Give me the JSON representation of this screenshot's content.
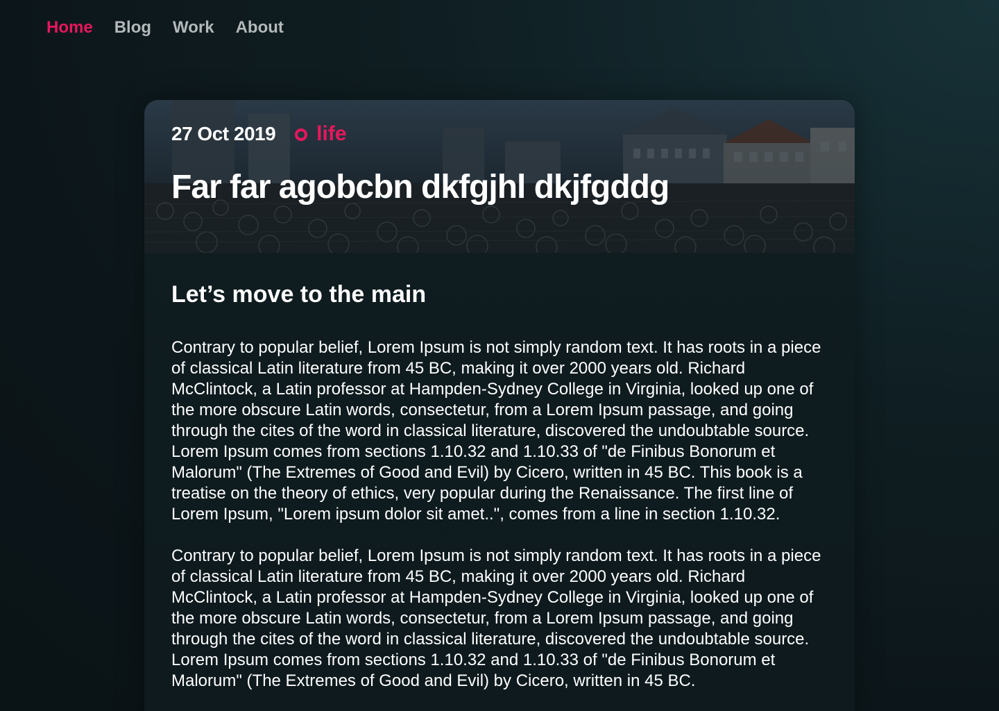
{
  "nav": {
    "items": [
      {
        "label": "Home",
        "active": true
      },
      {
        "label": "Blog",
        "active": false
      },
      {
        "label": "Work",
        "active": false
      },
      {
        "label": "About",
        "active": false
      }
    ]
  },
  "post": {
    "date": "27 Oct 2019",
    "tag": "life",
    "title": "Far far agobcbn dkfgjhl dkjfgddg",
    "hero_image": "bicycles-in-city-square",
    "subheading": "Let’s move to the main",
    "paragraphs": [
      "Contrary to popular belief, Lorem Ipsum is not simply random text. It has roots in a piece of classical Latin literature from 45 BC, making it over 2000 years old. Richard McClintock, a Latin professor at Hampden-Sydney College in Virginia, looked up one of the more obscure Latin words, consectetur, from a Lorem Ipsum passage, and going through the cites of the word in classical literature, discovered the undoubtable source. Lorem Ipsum comes from sections 1.10.32 and 1.10.33 of \"de Finibus Bonorum et Malorum\" (The Extremes of Good and Evil) by Cicero, written in 45 BC. This book is a treatise on the theory of ethics, very popular during the Renaissance. The first line of Lorem Ipsum, \"Lorem ipsum dolor sit amet..\", comes from a line in section 1.10.32.",
      "Contrary to popular belief, Lorem Ipsum is not simply random text. It has roots in a piece of classical Latin literature from 45 BC, making it over 2000 years old. Richard McClintock, a Latin professor at Hampden-Sydney College in Virginia, looked up one of the more obscure Latin words, consectetur, from a Lorem Ipsum passage, and going through the cites of the word in classical literature, discovered the undoubtable source. Lorem Ipsum comes from sections 1.10.32 and 1.10.33 of \"de Finibus Bonorum et Malorum\" (The Extremes of Good and Evil) by Cicero, written in 45 BC."
    ]
  },
  "colors": {
    "accent": "#e8175d",
    "nav_text": "#b3b9bb",
    "background": "#0c1519",
    "text": "#ffffff"
  }
}
